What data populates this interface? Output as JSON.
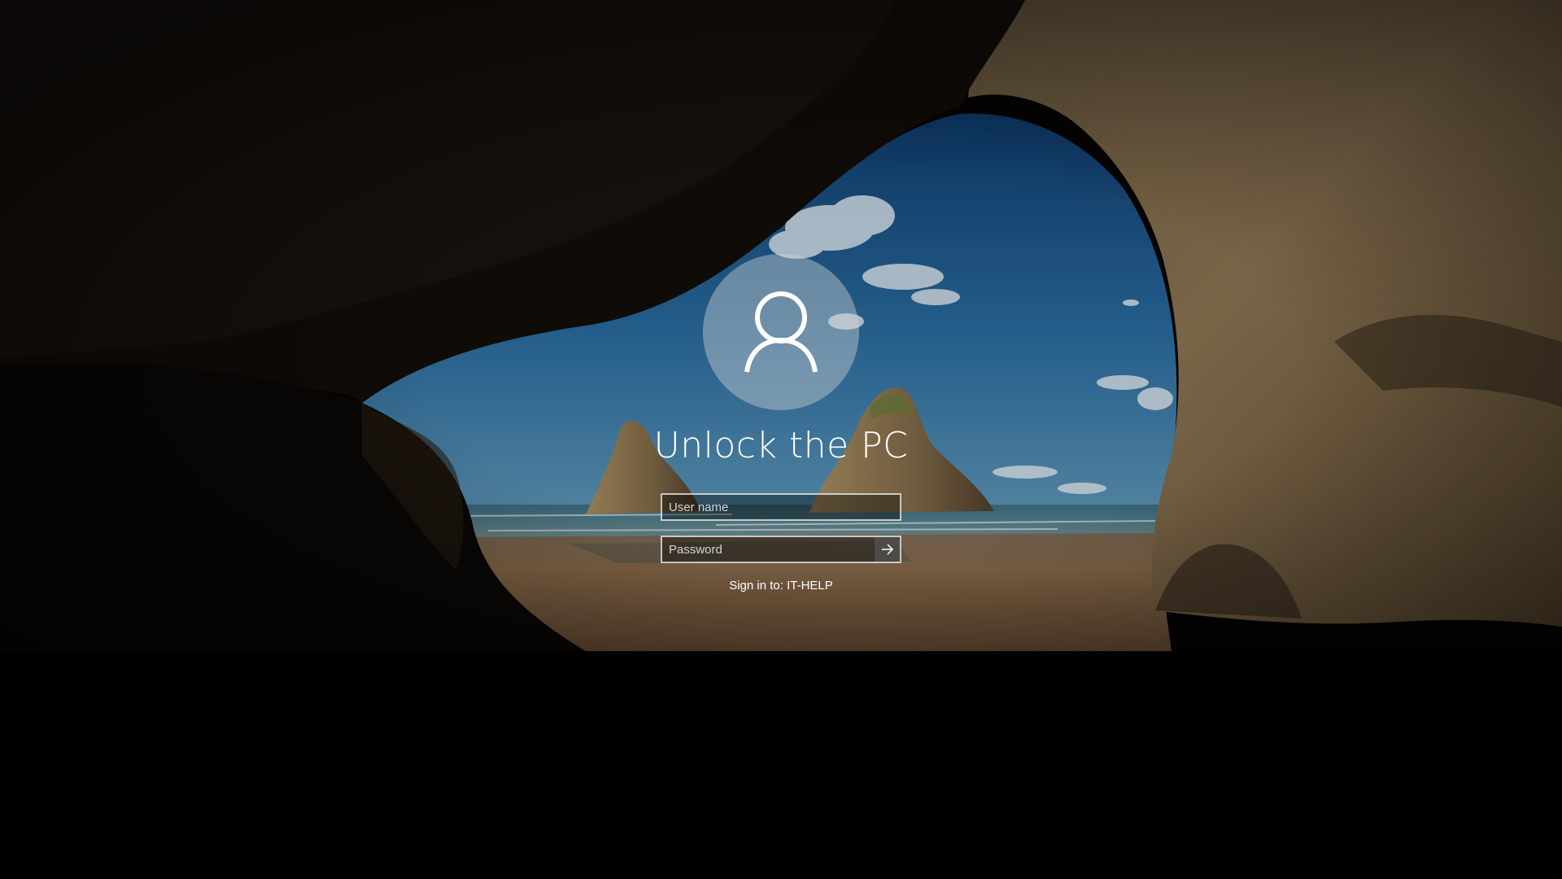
{
  "lock_screen": {
    "title": "Unlock the PC",
    "username": {
      "placeholder": "User name",
      "value": ""
    },
    "password": {
      "placeholder": "Password",
      "value": ""
    },
    "submit_icon": "arrow-right-icon",
    "avatar_icon": "user-icon",
    "sign_in_to": "Sign in to: IT-HELP"
  },
  "colors": {
    "sky": "#2c6a9c",
    "sand": "#9a7650",
    "rock": "#5a4a34",
    "background": "#000000"
  }
}
